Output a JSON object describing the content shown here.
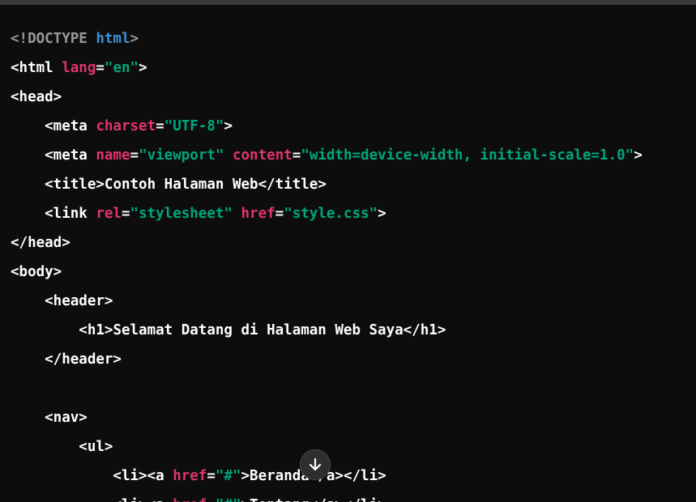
{
  "code_lines": [
    [
      {
        "t": "<!DOCTYPE ",
        "c": "doctype"
      },
      {
        "t": "html",
        "c": "kw"
      },
      {
        "t": ">",
        "c": "doctype"
      }
    ],
    [
      {
        "t": "<html ",
        "c": "tag"
      },
      {
        "t": "lang",
        "c": "attr"
      },
      {
        "t": "=",
        "c": "tag"
      },
      {
        "t": "\"en\"",
        "c": "str"
      },
      {
        "t": ">",
        "c": "tag"
      }
    ],
    [
      {
        "t": "<head>",
        "c": "tag"
      }
    ],
    [
      {
        "t": "    <meta ",
        "c": "tag"
      },
      {
        "t": "charset",
        "c": "attr"
      },
      {
        "t": "=",
        "c": "tag"
      },
      {
        "t": "\"UTF-8\"",
        "c": "str"
      },
      {
        "t": ">",
        "c": "tag"
      }
    ],
    [
      {
        "t": "    <meta ",
        "c": "tag"
      },
      {
        "t": "name",
        "c": "attr"
      },
      {
        "t": "=",
        "c": "tag"
      },
      {
        "t": "\"viewport\"",
        "c": "str"
      },
      {
        "t": " ",
        "c": "tag"
      },
      {
        "t": "content",
        "c": "attr"
      },
      {
        "t": "=",
        "c": "tag"
      },
      {
        "t": "\"width=device-width, initial-scale=1.0\"",
        "c": "str"
      },
      {
        "t": ">",
        "c": "tag"
      }
    ],
    [
      {
        "t": "    <title>",
        "c": "tag"
      },
      {
        "t": "Contoh Halaman Web",
        "c": "text"
      },
      {
        "t": "</title>",
        "c": "tag"
      }
    ],
    [
      {
        "t": "    <link ",
        "c": "tag"
      },
      {
        "t": "rel",
        "c": "attr"
      },
      {
        "t": "=",
        "c": "tag"
      },
      {
        "t": "\"stylesheet\"",
        "c": "str"
      },
      {
        "t": " ",
        "c": "tag"
      },
      {
        "t": "href",
        "c": "attr"
      },
      {
        "t": "=",
        "c": "tag"
      },
      {
        "t": "\"style.css\"",
        "c": "str"
      },
      {
        "t": ">",
        "c": "tag"
      }
    ],
    [
      {
        "t": "</head>",
        "c": "tag"
      }
    ],
    [
      {
        "t": "<body>",
        "c": "tag"
      }
    ],
    [
      {
        "t": "    <header>",
        "c": "tag"
      }
    ],
    [
      {
        "t": "        <h1>",
        "c": "tag"
      },
      {
        "t": "Selamat Datang di Halaman Web Saya",
        "c": "text"
      },
      {
        "t": "</h1>",
        "c": "tag"
      }
    ],
    [
      {
        "t": "    </header>",
        "c": "tag"
      }
    ],
    [],
    [
      {
        "t": "    <nav>",
        "c": "tag"
      }
    ],
    [
      {
        "t": "        <ul>",
        "c": "tag"
      }
    ],
    [
      {
        "t": "            <li><a ",
        "c": "tag"
      },
      {
        "t": "href",
        "c": "attr"
      },
      {
        "t": "=",
        "c": "tag"
      },
      {
        "t": "\"#\"",
        "c": "str"
      },
      {
        "t": ">",
        "c": "tag"
      },
      {
        "t": "Beranda",
        "c": "text"
      },
      {
        "t": "</a></li>",
        "c": "tag"
      }
    ],
    [
      {
        "t": "            <li><a ",
        "c": "tag"
      },
      {
        "t": "href",
        "c": "attr"
      },
      {
        "t": "=",
        "c": "tag"
      },
      {
        "t": "\"#\"",
        "c": "str"
      },
      {
        "t": ">",
        "c": "tag"
      },
      {
        "t": "Tentang",
        "c": "text"
      },
      {
        "t": "</a></li>",
        "c": "tag"
      }
    ]
  ],
  "scroll_button": {
    "icon": "arrow-down-icon"
  },
  "colors": {
    "background": "#0d0d0d",
    "tag": "#ffffff",
    "attribute": "#e0346f",
    "string": "#00a67d",
    "keyword": "#3d8fd6",
    "doctype": "#9a9a9a"
  }
}
